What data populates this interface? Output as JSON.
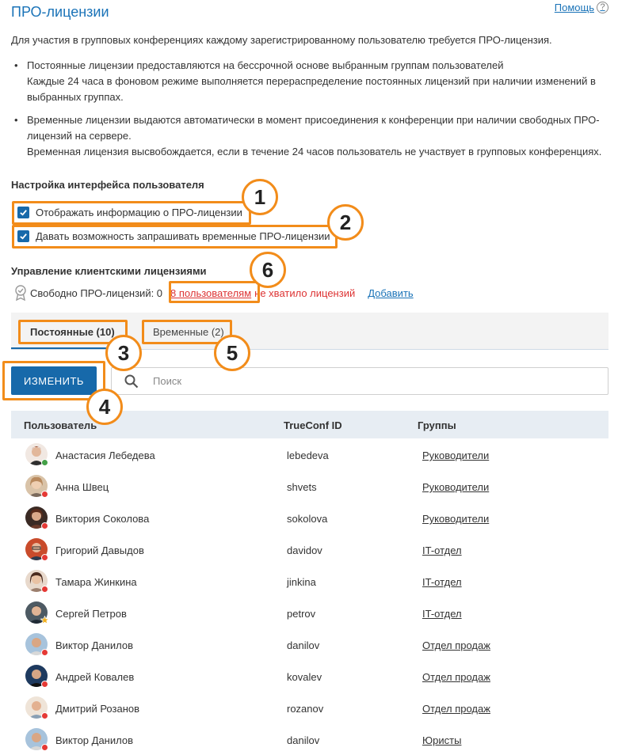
{
  "header": {
    "title": "ПРО-лицензии",
    "help_label": "Помощь",
    "help_icon_glyph": "?"
  },
  "intro": "Для участия в групповых конференциях каждому зарегистрированному пользователю требуется ПРО-лицензия.",
  "bullets": [
    {
      "line1": "Постоянные лицензии предоставляются на бессрочной основе выбранным группам пользователей",
      "line2": "Каждые 24 часа в фоновом режиме выполняется перераспределение постоянных лицензий при наличии изменений в",
      "line3": "выбранных группах."
    },
    {
      "line1": "Временные лицензии выдаются автоматически в момент присоединения к конференции при наличии свободных ПРО-",
      "line2": "лицензий на сервере.",
      "line3": "Временная лицензия высвобождается, если в течение 24 часов пользователь не участвует в групповых конференциях."
    }
  ],
  "ui_settings": {
    "title": "Настройка интерфейса пользователя",
    "show_pro_info_label": "Отображать информацию о ПРО-лицензии",
    "show_pro_info_checked": true,
    "allow_request_temp_label": "Давать возможность запрашивать временные ПРО-лицензии",
    "allow_request_temp_checked": true
  },
  "license_mgmt": {
    "title": "Управление клиентскими лицензиями",
    "free_label": "Свободно ПРО-лицензий: 0",
    "users_link": "8 пользователям",
    "not_enough_text": "не хватило лицензий",
    "add_link": "Добавить"
  },
  "tabs": {
    "permanent": "Постоянные (10)",
    "temporary": "Временные (2)"
  },
  "toolbar": {
    "change_button": "ИЗМЕНИТЬ",
    "search_placeholder": "Поиск"
  },
  "table": {
    "columns": [
      "Пользователь",
      "TrueConf ID",
      "Группы"
    ],
    "rows": [
      {
        "name": "Анастасия Лебедева",
        "id": "lebedeva",
        "group": "Руководители",
        "status": "online"
      },
      {
        "name": "Анна Швец",
        "id": "shvets",
        "group": "Руководители",
        "status": "offline"
      },
      {
        "name": "Виктория Соколова",
        "id": "sokolova",
        "group": "Руководители",
        "status": "offline"
      },
      {
        "name": "Григорий Давыдов",
        "id": "davidov",
        "group": "IT-отдел",
        "status": "offline"
      },
      {
        "name": "Тамара Жинкина",
        "id": "jinkina",
        "group": "IT-отдел",
        "status": "offline"
      },
      {
        "name": "Сергей Петров",
        "id": "petrov",
        "group": "IT-отдел",
        "status": "star"
      },
      {
        "name": "Виктор Данилов",
        "id": "danilov",
        "group": "Отдел продаж",
        "status": "offline"
      },
      {
        "name": "Андрей Ковалев",
        "id": "kovalev",
        "group": "Отдел продаж",
        "status": "offline"
      },
      {
        "name": "Дмитрий Розанов",
        "id": "rozanov",
        "group": "Отдел продаж",
        "status": "offline"
      },
      {
        "name": "Виктор Данилов",
        "id": "danilov",
        "group": "Юристы",
        "status": "offline"
      }
    ]
  },
  "callouts": [
    "1",
    "2",
    "3",
    "4",
    "5",
    "6"
  ],
  "colors": {
    "accent": "#1769aa",
    "highlight": "#f28c1a",
    "error": "#dd3333",
    "online": "#43a047",
    "offline": "#e53935"
  }
}
